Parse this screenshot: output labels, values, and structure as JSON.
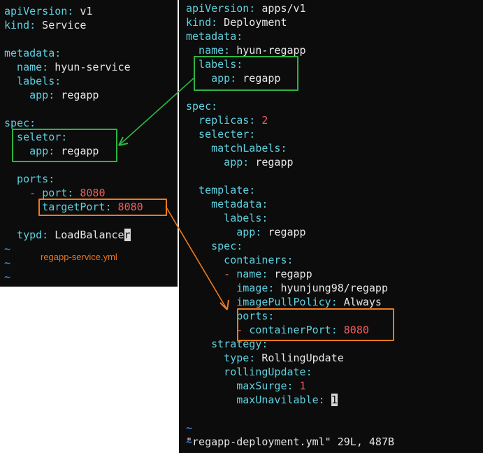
{
  "left": {
    "lines": [
      [
        {
          "t": "apiVersion:",
          "c": "k"
        },
        {
          "t": " v1",
          "c": "v"
        }
      ],
      [
        {
          "t": "kind:",
          "c": "k"
        },
        {
          "t": " Service",
          "c": "v"
        }
      ],
      [],
      [
        {
          "t": "metadata:",
          "c": "k"
        }
      ],
      [
        {
          "t": "  name:",
          "c": "k"
        },
        {
          "t": " hyun-service",
          "c": "v"
        }
      ],
      [
        {
          "t": "  labels:",
          "c": "k"
        }
      ],
      [
        {
          "t": "    app:",
          "c": "k"
        },
        {
          "t": " regapp",
          "c": "v"
        }
      ],
      [],
      [
        {
          "t": "spec:",
          "c": "k"
        }
      ],
      [
        {
          "t": "  seletor:",
          "c": "k"
        }
      ],
      [
        {
          "t": "    app:",
          "c": "k"
        },
        {
          "t": " regapp",
          "c": "v"
        }
      ],
      [],
      [
        {
          "t": "  ports:",
          "c": "k"
        }
      ],
      [
        {
          "t": "    - ",
          "c": "n"
        },
        {
          "t": "port:",
          "c": "k"
        },
        {
          "t": " 8080",
          "c": "n"
        }
      ],
      [
        {
          "t": "      targetPort:",
          "c": "k"
        },
        {
          "t": " 8080",
          "c": "n"
        }
      ],
      [],
      [
        {
          "t": "  typd:",
          "c": "k"
        },
        {
          "t": " LoadBalance",
          "c": "v"
        },
        {
          "t": "r",
          "c": "cur"
        }
      ],
      [
        {
          "t": "~",
          "c": "t"
        }
      ],
      [
        {
          "t": "~",
          "c": "t"
        }
      ],
      [
        {
          "t": "~",
          "c": "t"
        }
      ]
    ],
    "caption": "regapp-service.yml"
  },
  "right": {
    "lines": [
      [
        {
          "t": "apiVersion:",
          "c": "k"
        },
        {
          "t": " apps/v1",
          "c": "v"
        }
      ],
      [
        {
          "t": "kind:",
          "c": "k"
        },
        {
          "t": " Deployment",
          "c": "v"
        }
      ],
      [
        {
          "t": "metadata:",
          "c": "k"
        }
      ],
      [
        {
          "t": "  name:",
          "c": "k"
        },
        {
          "t": " hyun-regapp",
          "c": "v"
        }
      ],
      [
        {
          "t": "  labels:",
          "c": "k"
        }
      ],
      [
        {
          "t": "    app:",
          "c": "k"
        },
        {
          "t": " regapp",
          "c": "v"
        }
      ],
      [],
      [
        {
          "t": "spec:",
          "c": "k"
        }
      ],
      [
        {
          "t": "  replicas:",
          "c": "k"
        },
        {
          "t": " 2",
          "c": "n"
        }
      ],
      [
        {
          "t": "  selecter:",
          "c": "k"
        }
      ],
      [
        {
          "t": "    matchLabels:",
          "c": "k"
        }
      ],
      [
        {
          "t": "      app:",
          "c": "k"
        },
        {
          "t": " regapp",
          "c": "v"
        }
      ],
      [],
      [
        {
          "t": "  template:",
          "c": "k"
        }
      ],
      [
        {
          "t": "    metadata:",
          "c": "k"
        }
      ],
      [
        {
          "t": "      labels:",
          "c": "k"
        }
      ],
      [
        {
          "t": "        app:",
          "c": "k"
        },
        {
          "t": " regapp",
          "c": "v"
        }
      ],
      [
        {
          "t": "    spec:",
          "c": "k"
        }
      ],
      [
        {
          "t": "      containers:",
          "c": "k"
        }
      ],
      [
        {
          "t": "      - ",
          "c": "n"
        },
        {
          "t": "name:",
          "c": "k"
        },
        {
          "t": " regapp",
          "c": "v"
        }
      ],
      [
        {
          "t": "        image:",
          "c": "k"
        },
        {
          "t": " hyunjung98/regapp",
          "c": "v"
        }
      ],
      [
        {
          "t": "        imagePullPolicy:",
          "c": "k"
        },
        {
          "t": " Always",
          "c": "v"
        }
      ],
      [
        {
          "t": "        ports:",
          "c": "k"
        }
      ],
      [
        {
          "t": "        - ",
          "c": "n"
        },
        {
          "t": "containerPort:",
          "c": "k"
        },
        {
          "t": " 8080",
          "c": "n"
        }
      ],
      [
        {
          "t": "    strategy:",
          "c": "k"
        }
      ],
      [
        {
          "t": "      type:",
          "c": "k"
        },
        {
          "t": " RollingUpdate",
          "c": "v"
        }
      ],
      [
        {
          "t": "      rollingUpdate:",
          "c": "k"
        }
      ],
      [
        {
          "t": "        maxSurge:",
          "c": "k"
        },
        {
          "t": " 1",
          "c": "n"
        }
      ],
      [
        {
          "t": "        maxUnavilable:",
          "c": "k"
        },
        {
          "t": " ",
          "c": "v"
        },
        {
          "t": "1",
          "c": "cur"
        }
      ],
      [],
      [
        {
          "t": "~",
          "c": "t"
        }
      ],
      [
        {
          "t": "~",
          "c": "t"
        }
      ]
    ],
    "status": "\"regapp-deployment.yml\" 29L, 487B"
  },
  "colors": {
    "background": "#0c0c0c",
    "key": "#5fd0df",
    "value": "#e6e6e6",
    "number": "#ef5f5f",
    "tilde": "#4aa0ff",
    "highlight_green": "#2db542",
    "highlight_orange": "#f07b1e"
  }
}
